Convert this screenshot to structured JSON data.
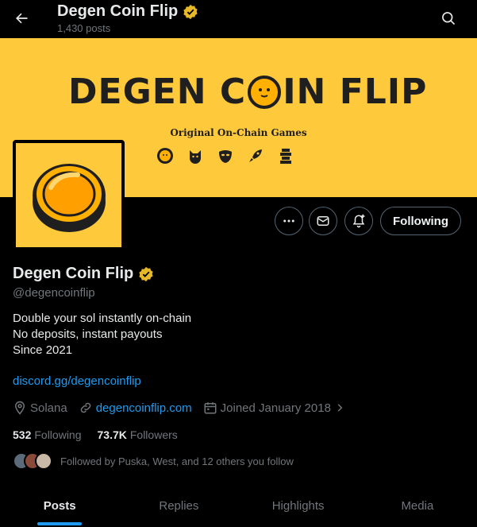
{
  "header": {
    "title": "Degen Coin Flip",
    "posts_count": "1,430 posts"
  },
  "banner": {
    "title_part1": "DEGEN C",
    "title_part2": "IN FLIP",
    "tagline": "Original On-Chain Games"
  },
  "actions": {
    "follow_label": "Following"
  },
  "profile": {
    "name": "Degen Coin Flip",
    "handle": "@degencoinflip",
    "bio": [
      "Double your sol instantly on-chain",
      "No deposits, instant payouts",
      "Since 2021"
    ],
    "link": "discord.gg/degencoinflip",
    "location": "Solana",
    "website": "degencoinflip.com",
    "joined": "Joined January 2018",
    "following_count": "532",
    "following_label": "Following",
    "followers_count": "73.7K",
    "followers_label": "Followers",
    "followed_by": "Followed by Puska, West, and 12 others you follow"
  },
  "tabs": [
    "Posts",
    "Replies",
    "Highlights",
    "Media"
  ],
  "colors": {
    "accent": "#1d9bf0",
    "banner": "#ffc93c",
    "verified": "#e7b928"
  }
}
